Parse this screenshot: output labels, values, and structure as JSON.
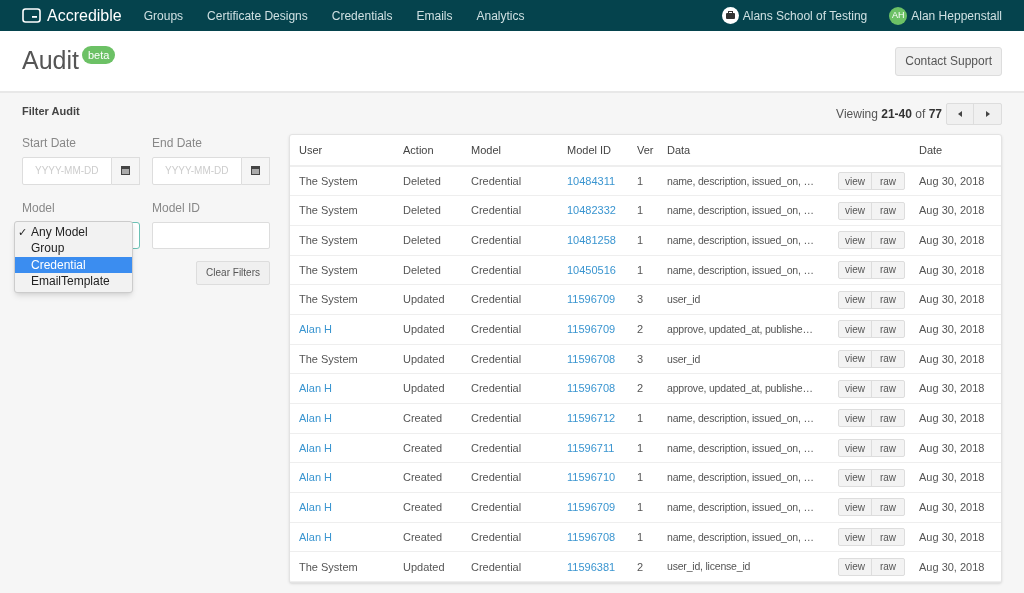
{
  "nav": {
    "brand": "Accredible",
    "links": [
      "Groups",
      "Certificate Designs",
      "Credentials",
      "Emails",
      "Analytics"
    ],
    "organization": "Alans School of Testing",
    "user": {
      "initials": "AH",
      "name": "Alan Heppenstall"
    }
  },
  "header": {
    "title": "Audit",
    "badge": "beta",
    "support_button": "Contact Support"
  },
  "filter": {
    "title": "Filter Audit",
    "start_date": {
      "label": "Start Date",
      "placeholder": "YYYY-MM-DD"
    },
    "end_date": {
      "label": "End Date",
      "placeholder": "YYYY-MM-DD"
    },
    "model": {
      "label": "Model",
      "check_mark": "✓",
      "options": [
        {
          "label": "Any Model",
          "checked": true,
          "selected": false
        },
        {
          "label": "Group",
          "checked": false,
          "selected": false
        },
        {
          "label": "Credential",
          "checked": false,
          "selected": true
        },
        {
          "label": "EmailTemplate",
          "checked": false,
          "selected": false
        }
      ]
    },
    "model_id": {
      "label": "Model ID"
    },
    "clear_button": "Clear Filters"
  },
  "pagination": {
    "text": "Viewing **21-40** of **77**"
  },
  "table": {
    "columns": [
      "User",
      "Action",
      "Model",
      "Model ID",
      "Ver",
      "Data",
      "Date"
    ],
    "rows": [
      {
        "user": "The System",
        "user_link": false,
        "action": "Deleted",
        "model": "Credential",
        "model_id": "10484311",
        "ver": "1",
        "data": "name, description, issued_on, …",
        "view": "view",
        "raw": "raw",
        "date": "Aug 30, 2018"
      },
      {
        "user": "The System",
        "user_link": false,
        "action": "Deleted",
        "model": "Credential",
        "model_id": "10482332",
        "ver": "1",
        "data": "name, description, issued_on, …",
        "view": "view",
        "raw": "raw",
        "date": "Aug 30, 2018"
      },
      {
        "user": "The System",
        "user_link": false,
        "action": "Deleted",
        "model": "Credential",
        "model_id": "10481258",
        "ver": "1",
        "data": "name, description, issued_on, …",
        "view": "view",
        "raw": "raw",
        "date": "Aug 30, 2018"
      },
      {
        "user": "The System",
        "user_link": false,
        "action": "Deleted",
        "model": "Credential",
        "model_id": "10450516",
        "ver": "1",
        "data": "name, description, issued_on, …",
        "view": "view",
        "raw": "raw",
        "date": "Aug 30, 2018"
      },
      {
        "user": "The System",
        "user_link": false,
        "action": "Updated",
        "model": "Credential",
        "model_id": "11596709",
        "ver": "3",
        "data": "user_id",
        "view": "view",
        "raw": "raw",
        "date": "Aug 30, 2018"
      },
      {
        "user": "Alan H",
        "user_link": true,
        "action": "Updated",
        "model": "Credential",
        "model_id": "11596709",
        "ver": "2",
        "data": "approve, updated_at, publishe…",
        "view": "view",
        "raw": "raw",
        "date": "Aug 30, 2018"
      },
      {
        "user": "The System",
        "user_link": false,
        "action": "Updated",
        "model": "Credential",
        "model_id": "11596708",
        "ver": "3",
        "data": "user_id",
        "view": "view",
        "raw": "raw",
        "date": "Aug 30, 2018"
      },
      {
        "user": "Alan H",
        "user_link": true,
        "action": "Updated",
        "model": "Credential",
        "model_id": "11596708",
        "ver": "2",
        "data": "approve, updated_at, publishe…",
        "view": "view",
        "raw": "raw",
        "date": "Aug 30, 2018"
      },
      {
        "user": "Alan H",
        "user_link": true,
        "action": "Created",
        "model": "Credential",
        "model_id": "11596712",
        "ver": "1",
        "data": "name, description, issued_on, …",
        "view": "view",
        "raw": "raw",
        "date": "Aug 30, 2018"
      },
      {
        "user": "Alan H",
        "user_link": true,
        "action": "Created",
        "model": "Credential",
        "model_id": "11596711",
        "ver": "1",
        "data": "name, description, issued_on, …",
        "view": "view",
        "raw": "raw",
        "date": "Aug 30, 2018"
      },
      {
        "user": "Alan H",
        "user_link": true,
        "action": "Created",
        "model": "Credential",
        "model_id": "11596710",
        "ver": "1",
        "data": "name, description, issued_on, …",
        "view": "view",
        "raw": "raw",
        "date": "Aug 30, 2018"
      },
      {
        "user": "Alan H",
        "user_link": true,
        "action": "Created",
        "model": "Credential",
        "model_id": "11596709",
        "ver": "1",
        "data": "name, description, issued_on, …",
        "view": "view",
        "raw": "raw",
        "date": "Aug 30, 2018"
      },
      {
        "user": "Alan H",
        "user_link": true,
        "action": "Created",
        "model": "Credential",
        "model_id": "11596708",
        "ver": "1",
        "data": "name, description, issued_on, …",
        "view": "view",
        "raw": "raw",
        "date": "Aug 30, 2018"
      },
      {
        "user": "The System",
        "user_link": false,
        "action": "Updated",
        "model": "Credential",
        "model_id": "11596381",
        "ver": "2",
        "data": "user_id, license_id",
        "view": "view",
        "raw": "raw",
        "date": "Aug 30, 2018"
      }
    ]
  }
}
